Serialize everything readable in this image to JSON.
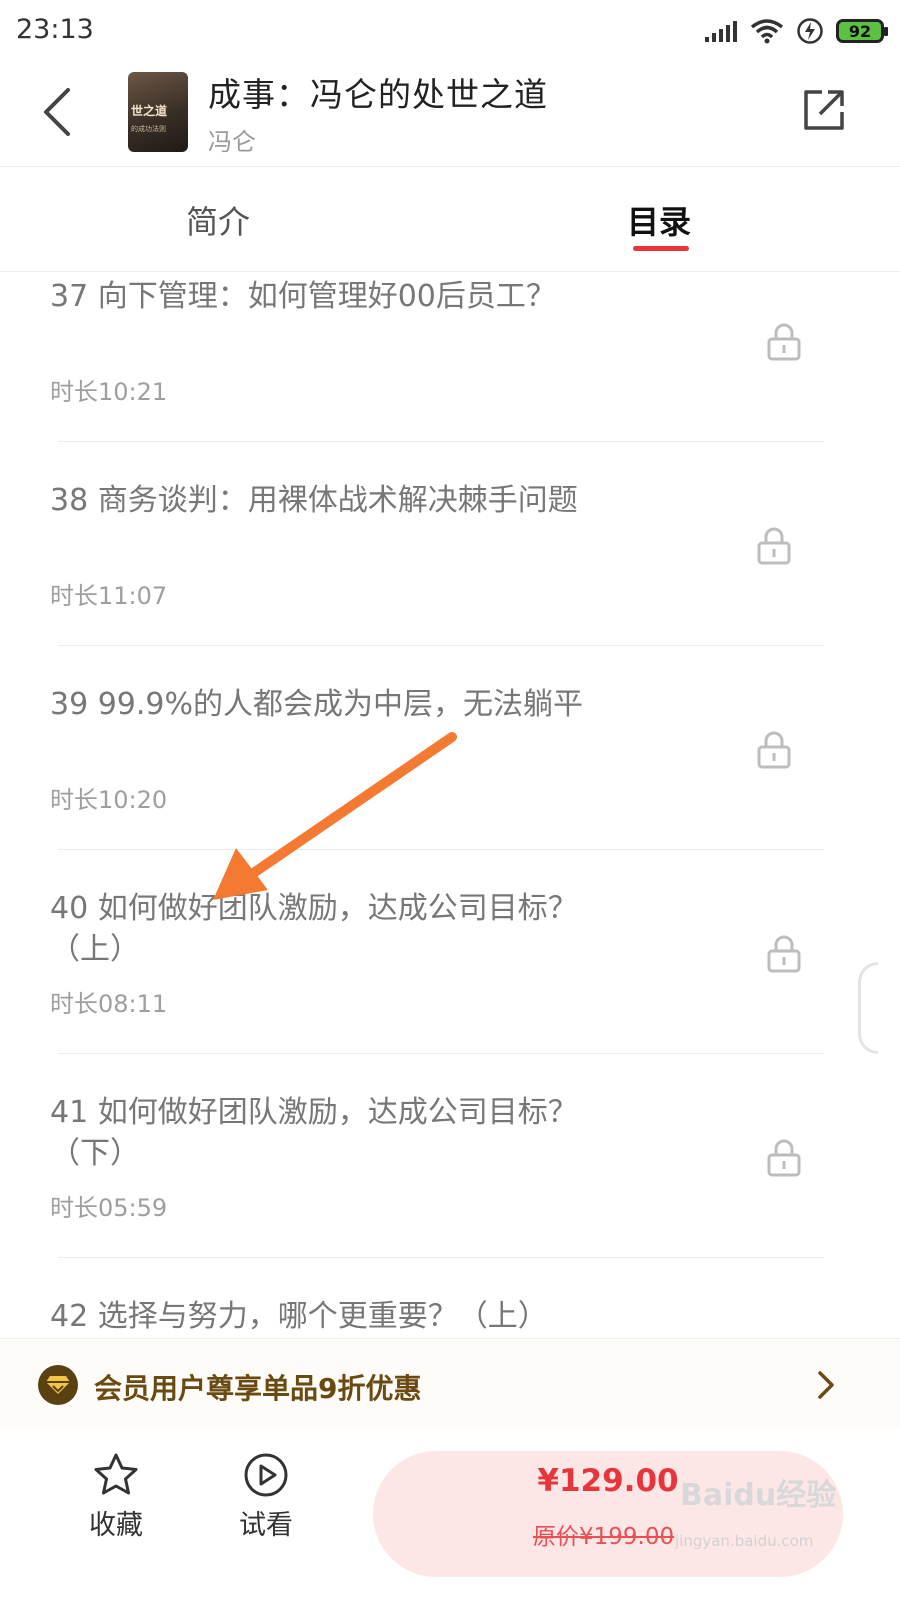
{
  "status": {
    "time": "23:13",
    "battery": "92"
  },
  "header": {
    "title": "成事：冯仑的处世之道",
    "author": "冯仑",
    "cover_title": "世之道",
    "cover_sub": "的成功法则"
  },
  "tabs": {
    "intro": "简介",
    "catalog": "目录"
  },
  "items": [
    {
      "title": "37 向下管理：如何管理好00后员工？",
      "duration": "时长10:21"
    },
    {
      "title": "38 商务谈判：用裸体战术解决棘手问题",
      "duration": "时长11:07"
    },
    {
      "title": "39 99.9%的人都会成为中层，无法躺平",
      "duration": "时长10:20"
    },
    {
      "title": "40 如何做好团队激励，达成公司目标？（上）",
      "duration": "时长08:11"
    },
    {
      "title": "41 如何做好团队激励，达成公司目标？（下）",
      "duration": "时长05:59"
    },
    {
      "title": "42 选择与努力，哪个更重要？（上）",
      "duration": ""
    }
  ],
  "member": {
    "text": "会员用户尊享单品9折优惠"
  },
  "bottom": {
    "favorite_label": "收藏",
    "trial_label": "试看",
    "price": "¥129.00",
    "original_price": "原价¥199.00"
  },
  "watermark": {
    "text": "Baidu经验",
    "sub": "jingyan.baidu.com"
  },
  "colors": {
    "accent": "#e8353b",
    "member_gold": "#6b4a12",
    "arrow": "#f47a32"
  }
}
